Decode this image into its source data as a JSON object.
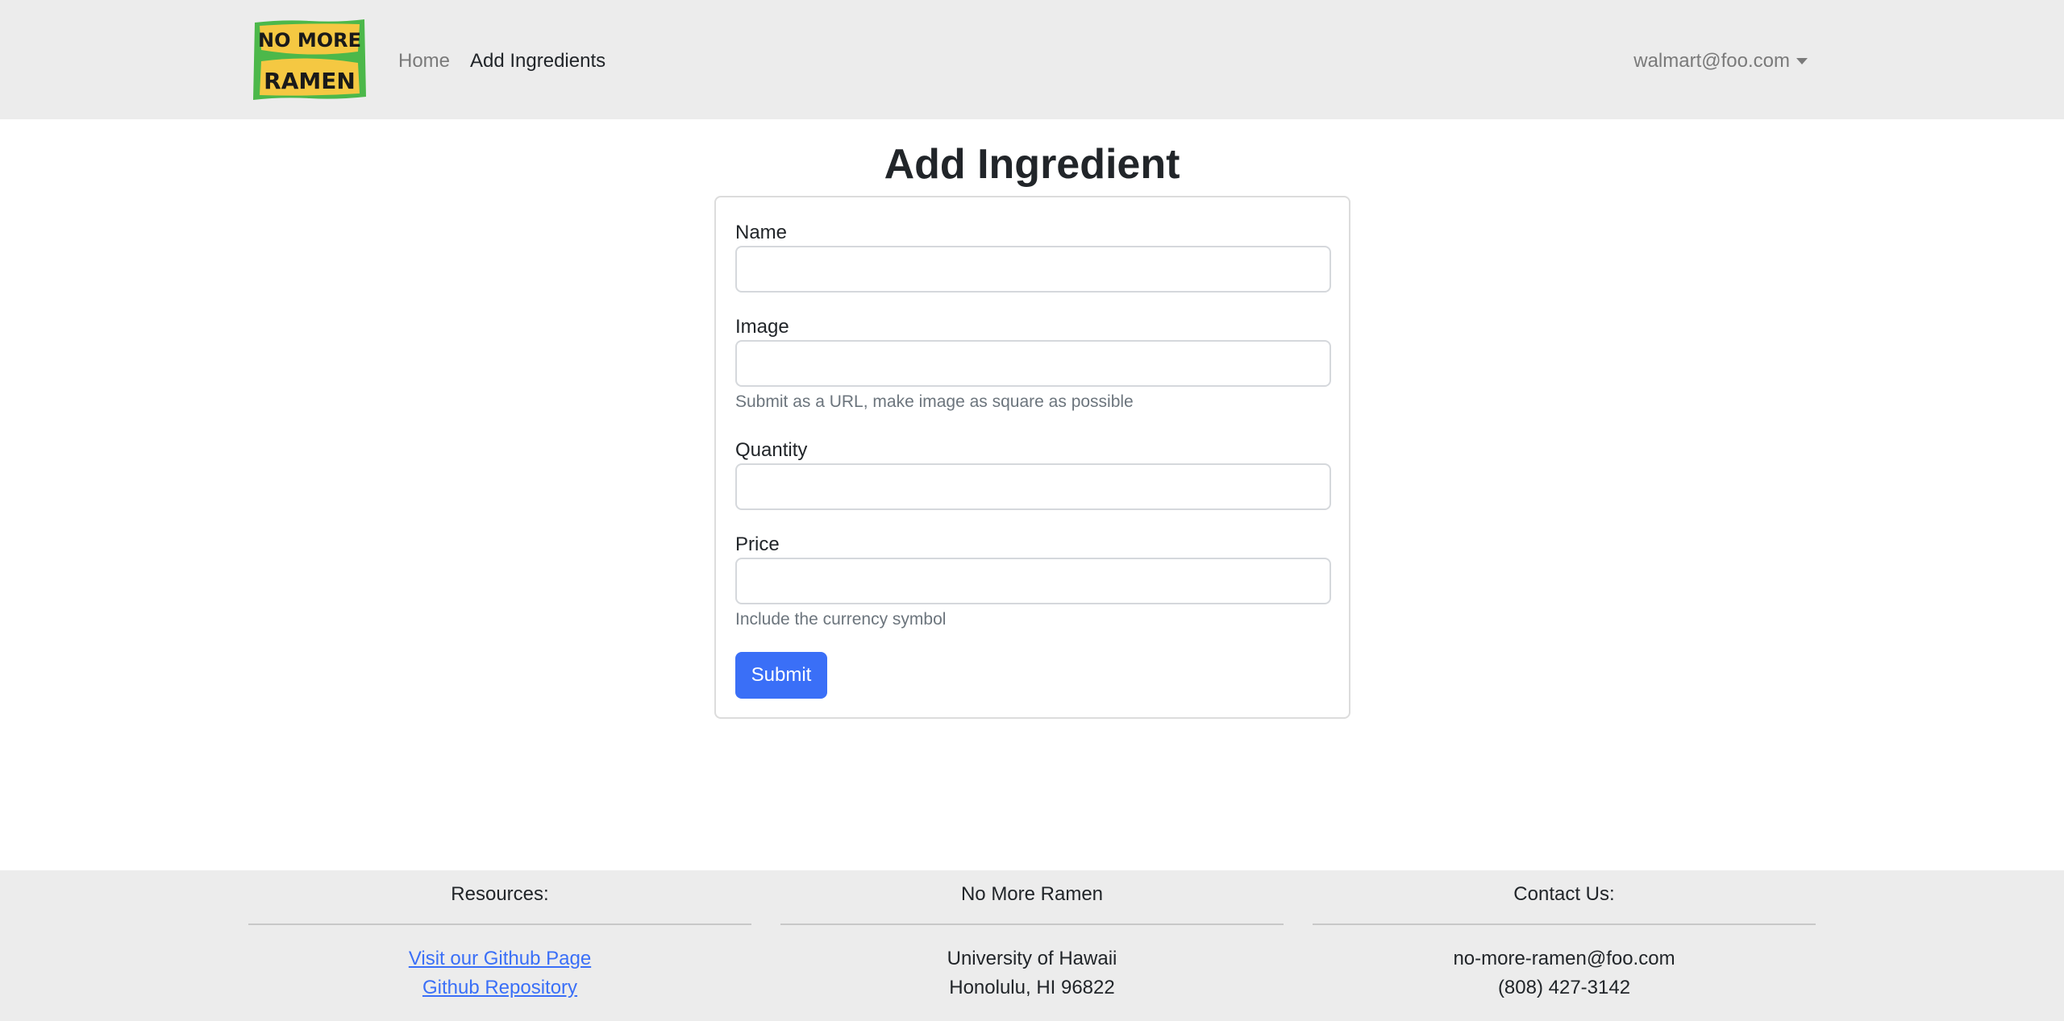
{
  "navbar": {
    "logo": {
      "line1": "NO MORE",
      "line2": "RAMEN",
      "colors": {
        "frame": "#4cb84a",
        "panel": "#f5c842",
        "text": "#1a1a1a"
      }
    },
    "links": {
      "home": "Home",
      "add_ingredients": "Add Ingredients"
    },
    "user_email": "walmart@foo.com"
  },
  "main": {
    "title": "Add Ingredient",
    "form": {
      "fields": {
        "name": {
          "label": "Name",
          "value": ""
        },
        "image": {
          "label": "Image",
          "value": "",
          "help": "Submit as a URL, make image as square as possible"
        },
        "quantity": {
          "label": "Quantity",
          "value": ""
        },
        "price": {
          "label": "Price",
          "value": "",
          "help": "Include the currency symbol"
        }
      },
      "submit_label": "Submit"
    }
  },
  "footer": {
    "resources": {
      "heading": "Resources:",
      "link1": "Visit our Github Page",
      "link2": "Github Repository"
    },
    "about": {
      "heading": "No More Ramen",
      "line1": "University of Hawaii",
      "line2": "Honolulu, HI 96822"
    },
    "contact": {
      "heading": "Contact Us:",
      "email": "no-more-ramen@foo.com",
      "phone": "(808) 427-3142"
    }
  },
  "colors": {
    "accent": "#3a6ff7",
    "navbar_bg": "#ececec",
    "footer_bg": "#ececec"
  }
}
